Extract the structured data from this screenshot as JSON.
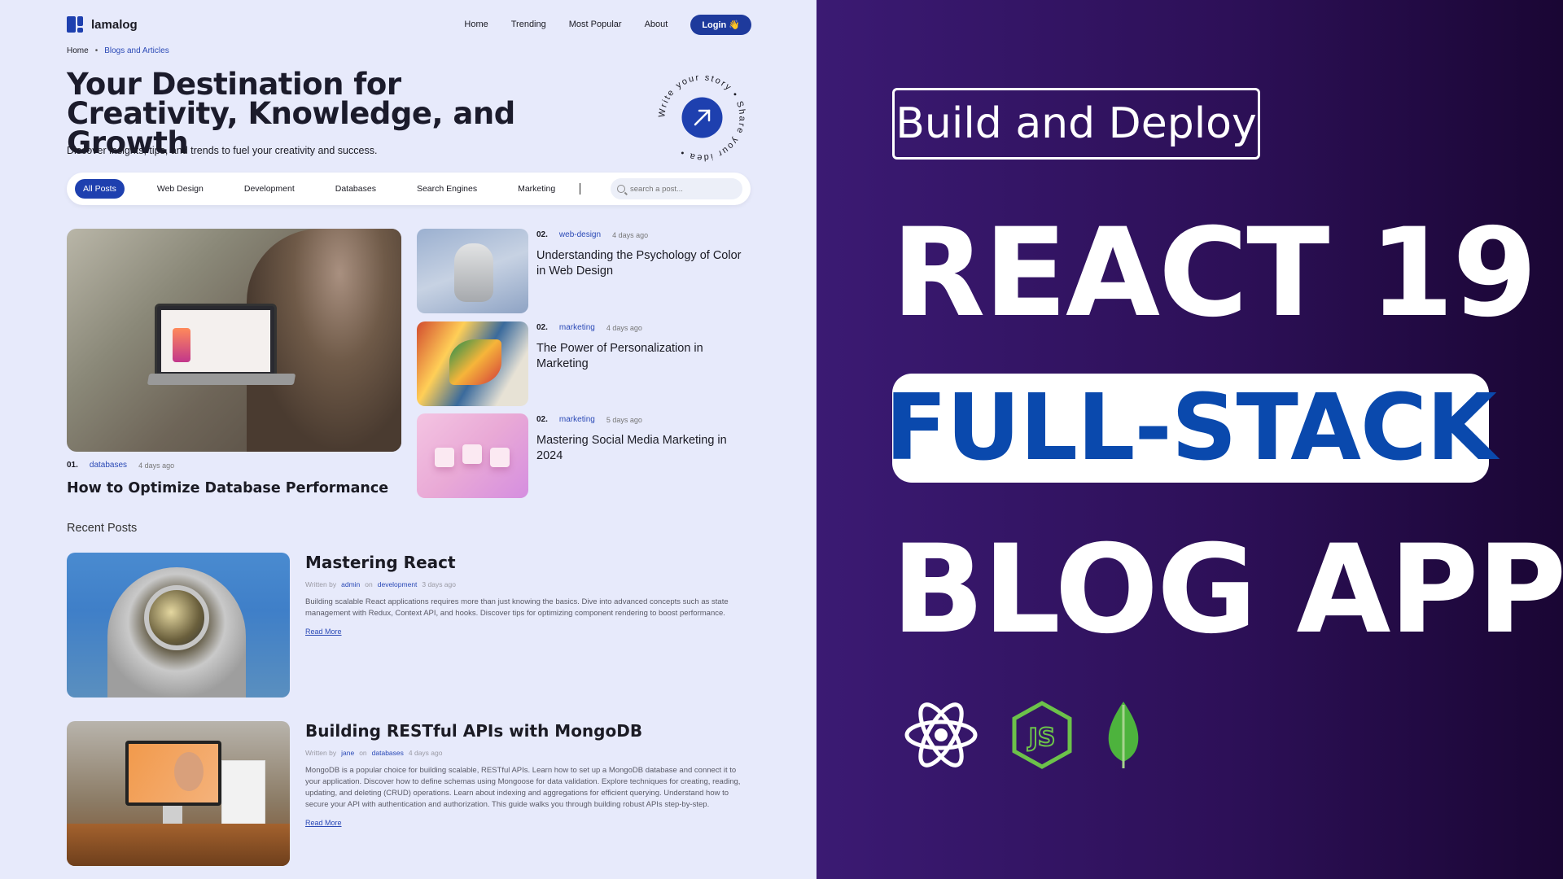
{
  "app": {
    "name": "lamalog"
  },
  "nav": {
    "links": [
      "Home",
      "Trending",
      "Most Popular",
      "About"
    ],
    "login": "Login 👋"
  },
  "breadcrumb": {
    "home": "Home",
    "sep": "•",
    "current": "Blogs and Articles"
  },
  "hero": {
    "title": "Your Destination for Creativity, Knowledge, and Growth",
    "subtitle": "Discover insights, tips, and trends to fuel your creativity and success.",
    "badge_text": "Write your story • Share your idea •"
  },
  "filters": {
    "items": [
      "All Posts",
      "Web Design",
      "Development",
      "Databases",
      "Search Engines",
      "Marketing"
    ],
    "active": "All Posts",
    "search_placeholder": "search a post..."
  },
  "featured": {
    "main": {
      "num": "01.",
      "category": "databases",
      "time": "4 days ago",
      "title": "How to Optimize Database Performance"
    },
    "side": [
      {
        "num": "02.",
        "category": "web-design",
        "time": "4 days ago",
        "title": "Understanding the Psychology of Color in Web Design"
      },
      {
        "num": "02.",
        "category": "marketing",
        "time": "4 days ago",
        "title": "The Power of Personalization in Marketing"
      },
      {
        "num": "02.",
        "category": "marketing",
        "time": "5 days ago",
        "title": "Mastering Social Media Marketing in 2024"
      }
    ]
  },
  "recent": {
    "heading": "Recent Posts",
    "posts": [
      {
        "title": "Mastering React",
        "written_by": "Written by",
        "author": "admin",
        "on": "on",
        "category": "development",
        "time": "3 days ago",
        "desc": "Building scalable React applications requires more than just knowing the basics. Dive into advanced concepts such as state management with Redux, Context API, and hooks. Discover tips for optimizing component rendering to boost performance.",
        "read_more": "Read More"
      },
      {
        "title": "Building RESTful APIs with MongoDB",
        "written_by": "Written by",
        "author": "jane",
        "on": "on",
        "category": "databases",
        "time": "4 days ago",
        "desc": "MongoDB is a popular choice for building scalable, RESTful APIs. Learn how to set up a MongoDB database and connect it to your application. Discover how to define schemas using Mongoose for data validation. Explore techniques for creating, reading, updating, and deleting (CRUD) operations. Learn about indexing and aggregations for efficient querying. Understand how to secure your API with authentication and authorization. This guide walks you through building robust APIs step-by-step.",
        "read_more": "Read More"
      }
    ]
  },
  "promo": {
    "build": "Build and Deploy",
    "react": "REACT 19",
    "fullstack": "FULL-STACK",
    "blogapp": "BLOG APP",
    "icons": [
      "react-icon",
      "nodejs-icon",
      "mongodb-icon"
    ],
    "colors": {
      "accent_blue": "#0a49ad",
      "bg_purple": "#3b1a73",
      "brand_blue": "#1e40af"
    }
  }
}
